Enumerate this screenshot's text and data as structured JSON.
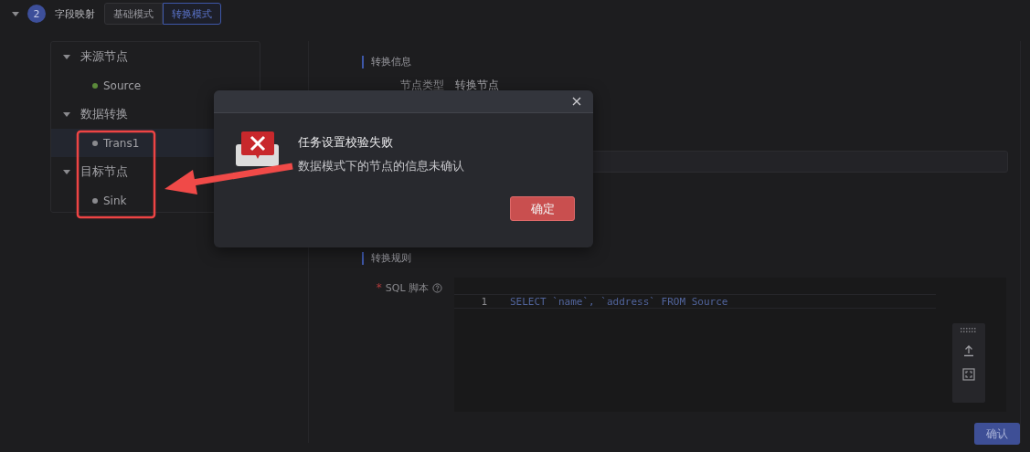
{
  "step": {
    "number": "2",
    "title": "字段映射",
    "expanded": true
  },
  "mode_tabs": [
    {
      "label": "基础模式",
      "selected": false
    },
    {
      "label": "转换模式",
      "selected": true
    }
  ],
  "tree": [
    {
      "label": "来源节点",
      "expanded": true,
      "children": [
        {
          "label": "Source",
          "color": "#5b8a3a",
          "selected": false
        }
      ]
    },
    {
      "label": "数据转换",
      "expanded": true,
      "children": [
        {
          "label": "Trans1",
          "color": "#8a8a8e",
          "selected": true
        }
      ]
    },
    {
      "label": "目标节点",
      "expanded": true,
      "children": [
        {
          "label": "Sink",
          "color": "#8a8a8e",
          "selected": false
        }
      ]
    }
  ],
  "info_section": {
    "title": "转换信息",
    "fields": [
      {
        "label": "节点类型",
        "value": "转换节点"
      }
    ]
  },
  "rule_section": {
    "title": "转换规则",
    "sql": {
      "label": "SQL 脚本",
      "required_mark": "*",
      "lines": [
        {
          "number": "1",
          "code": "SELECT `name`, `address` FROM Source"
        }
      ]
    }
  },
  "confirm_button": "确认",
  "dialog": {
    "title": "任务设置校验失败",
    "message": "数据模式下的节点的信息未确认",
    "ok_button": "确定"
  }
}
